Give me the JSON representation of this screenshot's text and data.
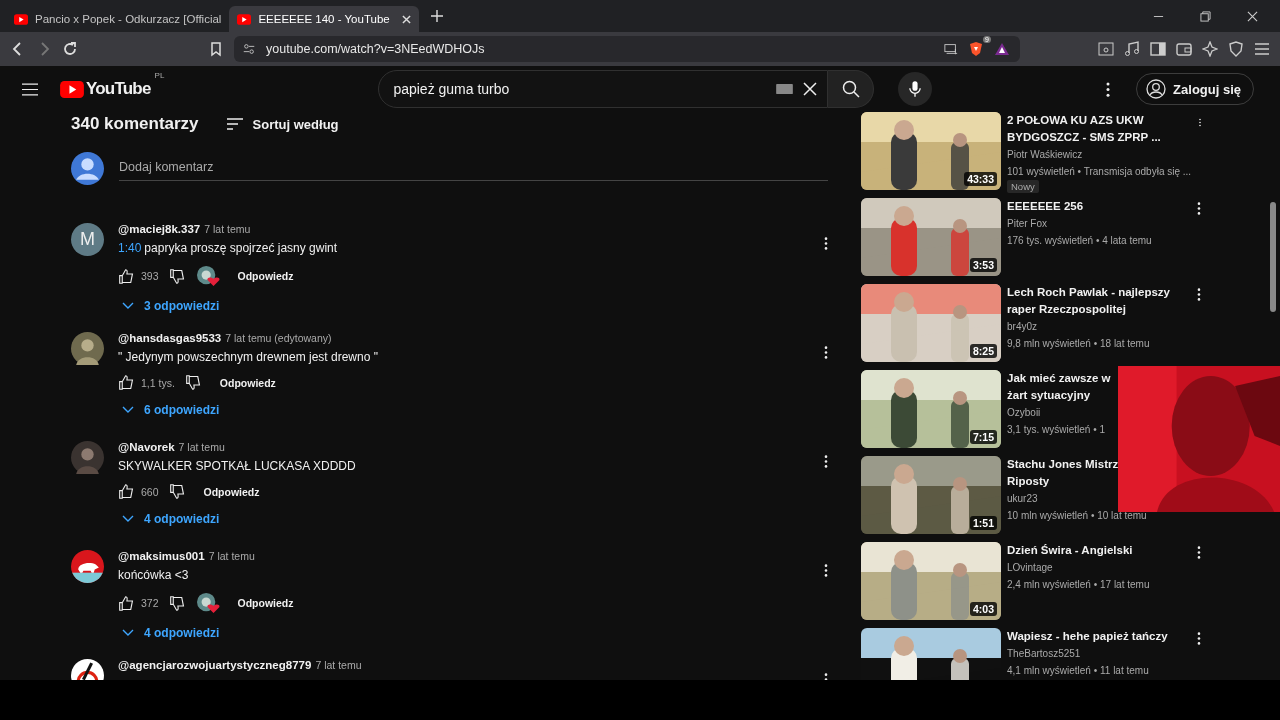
{
  "browser": {
    "tabs": [
      {
        "title": "Pancio x Popek - Odkurzacz [Official",
        "selected": false
      },
      {
        "title": "EEEEEEE 140 - YouTube",
        "selected": true
      }
    ],
    "url": "youtube.com/watch?v=3NEedWDHOJs",
    "shield_count": "9"
  },
  "header": {
    "logo": "YouTube",
    "region": "PL",
    "search": "papież guma turbo",
    "sign_in": "Zaloguj się"
  },
  "comments": {
    "count": "340 komentarzy",
    "sort": "Sortuj według",
    "placeholder": "Dodaj komentarz",
    "items": [
      {
        "kind": "letter",
        "letter": "M",
        "author": "@maciej8k.337",
        "time": "7 lat temu",
        "timestamp": "1:40",
        "text": "papryka proszę spojrzeć jasny gwint",
        "likes": "393",
        "hearted": true,
        "reply": "Odpowiedz",
        "replies": "3 odpowiedzi"
      },
      {
        "kind": "picture",
        "author": "@hansdasgas9533",
        "time": "7 lat temu (edytowany)",
        "text": "\" Jedynym powszechnym drewnem jest drewno \"",
        "likes": "1,1 tys.",
        "hearted": false,
        "reply": "Odpowiedz",
        "replies": "6 odpowiedzi"
      },
      {
        "kind": "picture",
        "author": "@Navorek",
        "time": "7 lat temu",
        "text": "SKYWALKER SPOTKAŁ LUCKASA XDDDD",
        "likes": "660",
        "hearted": false,
        "reply": "Odpowiedz",
        "replies": "4 odpowiedzi"
      },
      {
        "kind": "emblem",
        "author": "@maksimus001",
        "time": "7 lat temu",
        "text": "końcówka <3",
        "likes": "372",
        "hearted": true,
        "reply": "Odpowiedz",
        "replies": "4 odpowiedzi"
      },
      {
        "kind": "sign",
        "author": "@agencjarozwojuartystyczneg8779",
        "time": "7 lat temu"
      }
    ]
  },
  "videos": [
    {
      "title": "2 POŁOWA   KU AZS UKW BYDGOSZCZ - SMS ZPRP ...",
      "channel": "Piotr Waśkiewicz",
      "meta": "101 wyświetleń • Transmisja odbyła się ...",
      "duration": "43:33",
      "badge": "Nowy",
      "menu": true
    },
    {
      "title": "EEEEEEE 256",
      "channel": "Piter Fox",
      "meta": "176 tys. wyświetleń • 4 lata temu",
      "duration": "3:53",
      "menu": true
    },
    {
      "title": "Lech Roch Pawlak - najlepszy raper Rzeczpospolitej",
      "channel": "br4y0z",
      "meta": "9,8 mln wyświetleń • 18 lat temu",
      "duration": "8:25",
      "menu": true
    },
    {
      "title": "Jak mieć zawsze w",
      "title2": "żart sytuacyjny",
      "channel": "Ozyboii",
      "meta": "3,1 tys. wyświetleń • 1",
      "duration": "7:15",
      "menu": false
    },
    {
      "title": "Stachu Jones Mistrz",
      "title2": "Riposty",
      "channel": "ukur23",
      "meta": "10 mln wyświetleń • 10 lat temu",
      "duration": "1:51",
      "menu": false
    },
    {
      "title": "Dzień Świra - Angielski",
      "channel": "LOvintage",
      "meta": "2,4 mln wyświetleń • 17 lat temu",
      "duration": "4:03",
      "menu": true
    },
    {
      "title": "Wapiesz - hehe papież tańczy",
      "channel": "TheBartosz5251",
      "meta": "4,1 mln wyświetleń • 11 lat temu",
      "menu": true
    }
  ]
}
